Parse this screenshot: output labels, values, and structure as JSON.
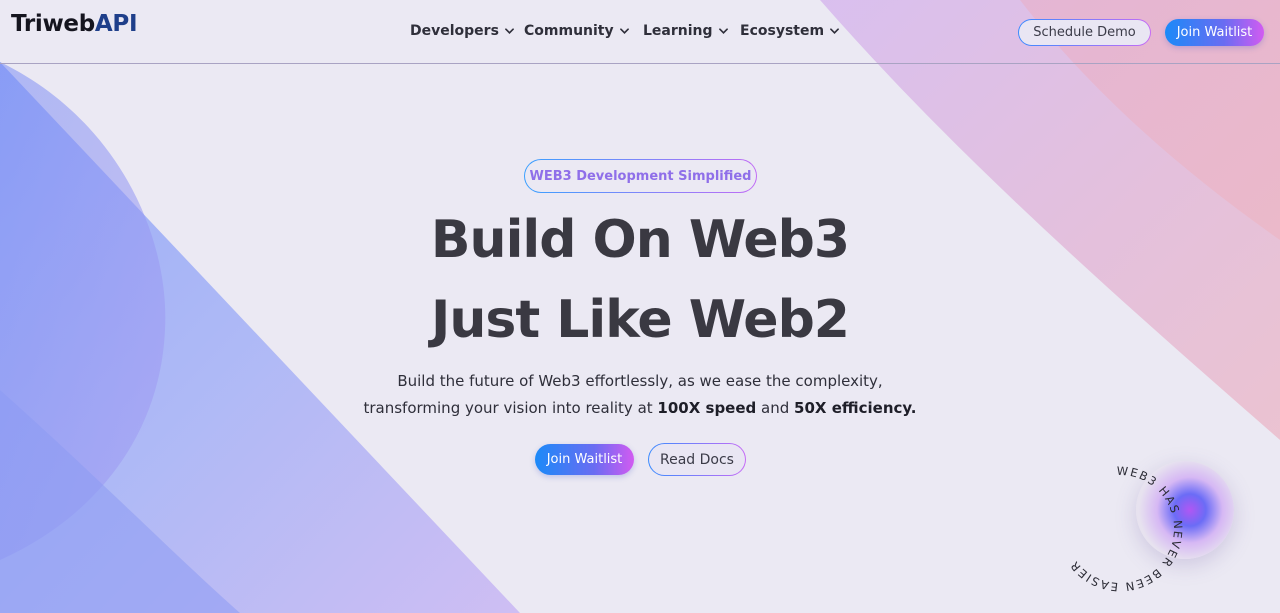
{
  "brand": {
    "logo_part1": "Triweb",
    "logo_part2": "API"
  },
  "nav": {
    "items": [
      {
        "label": "Developers"
      },
      {
        "label": "Community"
      },
      {
        "label": "Learning"
      },
      {
        "label": "Ecosystem"
      }
    ]
  },
  "header_actions": {
    "schedule_demo": "Schedule Demo",
    "join_waitlist": "Join Waitlist"
  },
  "hero": {
    "tagline": "WEB3 Development Simplified",
    "title_line1": "Build On Web3",
    "title_line2": "Just Like Web2",
    "subtitle_line1": "Build the future of Web3 effortlessly, as we ease the complexity,",
    "subtitle_line2_prefix": "transforming your vision into reality at ",
    "subtitle_line2_bold1": "100X speed",
    "subtitle_line2_mid": " and ",
    "subtitle_line2_bold2": "50X efficiency.",
    "cta_primary": "Join Waitlist",
    "cta_secondary": "Read Docs"
  },
  "badge": {
    "circular_text": "WEB3 HAS NEVER BEEN EASIER"
  },
  "colors": {
    "background": "#ebe9f3",
    "accent_blue": "#1b8af8",
    "accent_purple": "#d25bf1",
    "heading": "#3a3942",
    "logo_api": "#1f3f8a"
  }
}
